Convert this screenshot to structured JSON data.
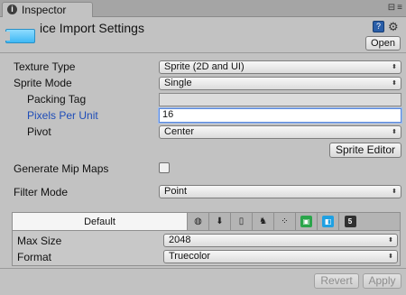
{
  "tab": {
    "title": "Inspector",
    "controls": "≡"
  },
  "header": {
    "title": "ice Import Settings",
    "open_label": "Open"
  },
  "fields": {
    "texture_type": {
      "label": "Texture Type",
      "value": "Sprite (2D and UI)"
    },
    "sprite_mode": {
      "label": "Sprite Mode",
      "value": "Single"
    },
    "packing_tag": {
      "label": "Packing Tag",
      "value": ""
    },
    "pixels_per_unit": {
      "label": "Pixels Per Unit",
      "value": "16"
    },
    "pivot": {
      "label": "Pivot",
      "value": "Center"
    },
    "sprite_editor_label": "Sprite Editor",
    "generate_mip_maps": {
      "label": "Generate Mip Maps",
      "checked": false
    },
    "filter_mode": {
      "label": "Filter Mode",
      "value": "Point"
    }
  },
  "platforms": {
    "default_label": "Default",
    "icons": [
      "web-globe-icon",
      "standalone-download-icon",
      "ios-phone-icon",
      "android-icon",
      "blackberry-icon",
      "windows-store-icon",
      "windows-phone-icon",
      "html5-icon"
    ],
    "colors": {
      "windows_store": "#2aa54a",
      "windows_phone": "#1fa0e2",
      "html5": "#303030"
    },
    "max_size": {
      "label": "Max Size",
      "value": "2048"
    },
    "format": {
      "label": "Format",
      "value": "Truecolor"
    }
  },
  "footer": {
    "revert_label": "Revert",
    "apply_label": "Apply"
  },
  "colors": {
    "highlight_label": "#1f4db8",
    "focus_border": "#5a87d8",
    "asset_icon": "#3fb8f4"
  }
}
